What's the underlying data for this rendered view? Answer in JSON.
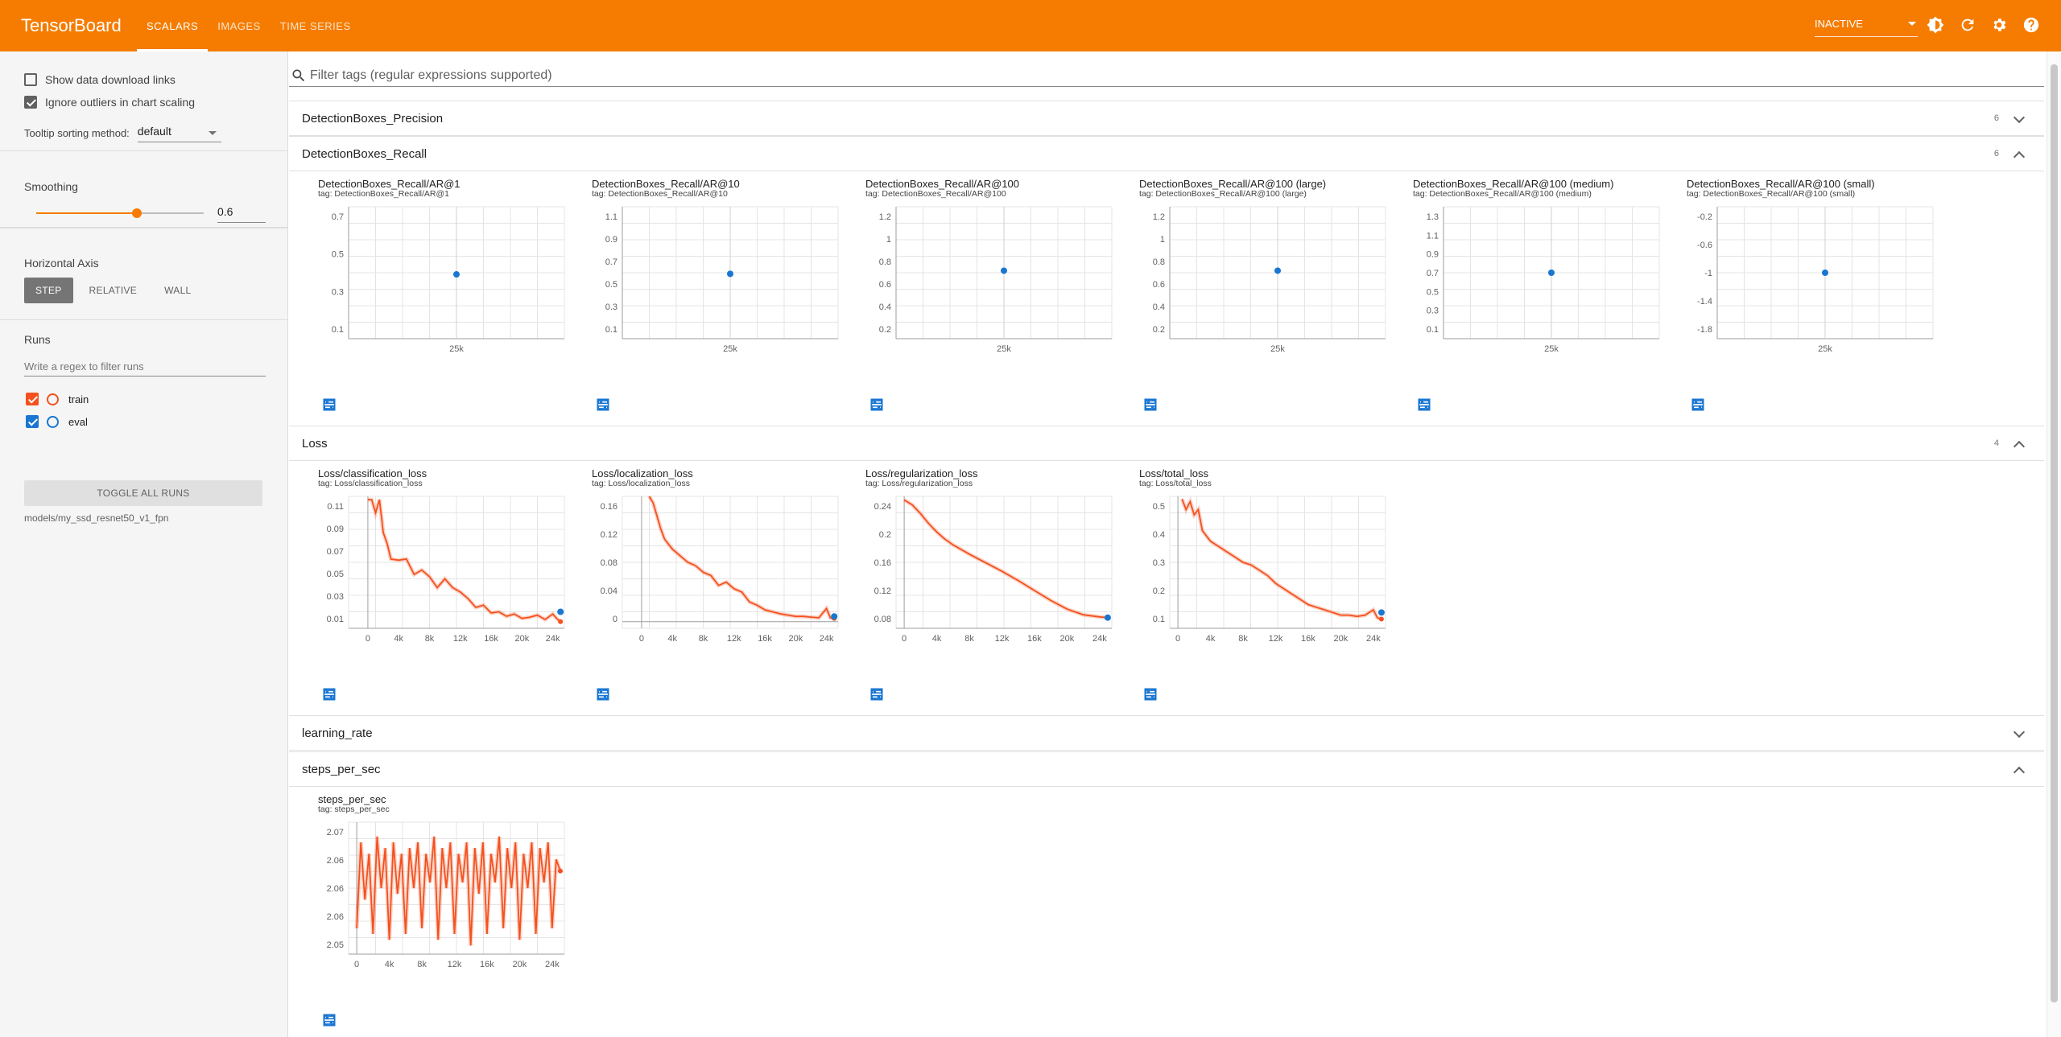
{
  "topbar": {
    "brand": "TensorBoard",
    "tabs": [
      {
        "label": "SCALARS",
        "active": true
      },
      {
        "label": "IMAGES",
        "active": false
      },
      {
        "label": "TIME SERIES",
        "active": false
      }
    ],
    "reload_status": "INACTIVE",
    "colors": {
      "bar": "#f57c00",
      "text": "#ffffff"
    },
    "icons": [
      "brightness-icon",
      "refresh-icon",
      "settings-icon",
      "help-icon"
    ]
  },
  "sidebar": {
    "show_download_links": {
      "label": "Show data download links",
      "checked": false
    },
    "ignore_outliers": {
      "label": "Ignore outliers in chart scaling",
      "checked": true
    },
    "tooltip_sorting": {
      "label": "Tooltip sorting method:",
      "value": "default"
    },
    "smoothing": {
      "label": "Smoothing",
      "value": "0.6",
      "fraction": 0.6
    },
    "horizontal_axis": {
      "label": "Horizontal Axis",
      "options": [
        "STEP",
        "RELATIVE",
        "WALL"
      ],
      "selected": "STEP"
    },
    "runs": {
      "label": "Runs",
      "filter_placeholder": "Write a regex to filter runs",
      "items": [
        {
          "name": "train",
          "color": "#f4511e",
          "checked": true
        },
        {
          "name": "eval",
          "color": "#1976d2",
          "checked": true
        }
      ],
      "toggle_all": "TOGGLE ALL RUNS",
      "logdir": "models/my_ssd_resnet50_v1_fpn"
    }
  },
  "filter": {
    "placeholder": "Filter tags (regular expressions supported)"
  },
  "groups": [
    {
      "name": "DetectionBoxes_Precision",
      "count": "6",
      "expanded": false
    },
    {
      "name": "DetectionBoxes_Recall",
      "count": "6",
      "expanded": true
    },
    {
      "name": "Loss",
      "count": "4",
      "expanded": true
    },
    {
      "name": "learning_rate",
      "count": "",
      "expanded": false
    },
    {
      "name": "steps_per_sec",
      "count": "",
      "expanded": true
    }
  ],
  "chart_data": [
    {
      "type": "scatter",
      "title": "DetectionBoxes_Recall/AR@1",
      "tag": "tag: DetectionBoxes_Recall/AR@1",
      "yticks": [
        "0.7",
        "0.5",
        "0.3",
        "0.1"
      ],
      "xticks": [
        "25k"
      ],
      "ylim": [
        0,
        0.8
      ],
      "xlim": [
        0,
        50000
      ],
      "series": [
        {
          "x": [
            25000
          ],
          "y": [
            0.39
          ],
          "color": "#1976d2"
        }
      ]
    },
    {
      "type": "scatter",
      "title": "DetectionBoxes_Recall/AR@10",
      "tag": "tag: DetectionBoxes_Recall/AR@10",
      "yticks": [
        "1.1",
        "0.9",
        "0.7",
        "0.5",
        "0.3",
        "0.1"
      ],
      "xticks": [
        "25k"
      ],
      "ylim": [
        0,
        1.2
      ],
      "xlim": [
        0,
        50000
      ],
      "series": [
        {
          "x": [
            25000
          ],
          "y": [
            0.59
          ],
          "color": "#1976d2"
        }
      ]
    },
    {
      "type": "scatter",
      "title": "DetectionBoxes_Recall/AR@100",
      "tag": "tag: DetectionBoxes_Recall/AR@100",
      "yticks": [
        "1.2",
        "1",
        "0.8",
        "0.6",
        "0.4",
        "0.2"
      ],
      "xticks": [
        "25k"
      ],
      "ylim": [
        0.05,
        1.35
      ],
      "xlim": [
        0,
        50000
      ],
      "series": [
        {
          "x": [
            25000
          ],
          "y": [
            0.72
          ],
          "color": "#1976d2"
        }
      ]
    },
    {
      "type": "scatter",
      "title": "DetectionBoxes_Recall/AR@100 (large)",
      "tag": "tag: DetectionBoxes_Recall/AR@100 (large)",
      "yticks": [
        "1.2",
        "1",
        "0.8",
        "0.6",
        "0.4",
        "0.2"
      ],
      "xticks": [
        "25k"
      ],
      "ylim": [
        0.05,
        1.35
      ],
      "xlim": [
        0,
        50000
      ],
      "series": [
        {
          "x": [
            25000
          ],
          "y": [
            0.72
          ],
          "color": "#1976d2"
        }
      ]
    },
    {
      "type": "scatter",
      "title": "DetectionBoxes_Recall/AR@100 (medium)",
      "tag": "tag: DetectionBoxes_Recall/AR@100 (medium)",
      "yticks": [
        "1.3",
        "1.1",
        "0.9",
        "0.7",
        "0.5",
        "0.3",
        "0.1"
      ],
      "xticks": [
        "25k"
      ],
      "ylim": [
        0,
        1.4
      ],
      "xlim": [
        0,
        50000
      ],
      "series": [
        {
          "x": [
            25000
          ],
          "y": [
            0.7
          ],
          "color": "#1976d2"
        }
      ]
    },
    {
      "type": "scatter",
      "title": "DetectionBoxes_Recall/AR@100 (small)",
      "tag": "tag: DetectionBoxes_Recall/AR@100 (small)",
      "yticks": [
        "-0.2",
        "-0.6",
        "-1",
        "-1.4",
        "-1.8"
      ],
      "xticks": [
        "25k"
      ],
      "ylim": [
        -2.0,
        0
      ],
      "xlim": [
        0,
        50000
      ],
      "series": [
        {
          "x": [
            25000
          ],
          "y": [
            -1.0
          ],
          "color": "#1976d2"
        }
      ]
    },
    {
      "type": "line",
      "title": "Loss/classification_loss",
      "tag": "tag: Loss/classification_loss",
      "yticks": [
        "0.11",
        "0.09",
        "0.07",
        "0.05",
        "0.03",
        "0.01"
      ],
      "xticks": [
        "0",
        "4k",
        "8k",
        "12k",
        "16k",
        "20k",
        "24k"
      ],
      "ylim": [
        0.003,
        0.123
      ],
      "xlim": [
        -2500,
        25500
      ],
      "series": [
        {
          "color": "#f4511e",
          "x": [
            0,
            500,
            1000,
            1500,
            2000,
            2500,
            3000,
            4000,
            5000,
            6000,
            7000,
            8000,
            9000,
            10000,
            11000,
            12000,
            13000,
            14000,
            15000,
            16000,
            17000,
            18000,
            19000,
            20000,
            21000,
            22000,
            23000,
            24000,
            24500,
            25000
          ],
          "y": [
            0.12,
            0.12,
            0.108,
            0.12,
            0.09,
            0.08,
            0.066,
            0.065,
            0.066,
            0.052,
            0.056,
            0.05,
            0.04,
            0.048,
            0.04,
            0.036,
            0.03,
            0.022,
            0.024,
            0.017,
            0.018,
            0.014,
            0.016,
            0.012,
            0.013,
            0.015,
            0.011,
            0.016,
            0.012,
            0.009
          ]
        },
        {
          "color": "#1976d2",
          "x": [
            25000
          ],
          "y": [
            0.018
          ]
        }
      ]
    },
    {
      "type": "line",
      "title": "Loss/localization_loss",
      "tag": "tag: Loss/localization_loss",
      "yticks": [
        "0.16",
        "0.12",
        "0.08",
        "0.04",
        "0"
      ],
      "xticks": [
        "0",
        "4k",
        "8k",
        "12k",
        "16k",
        "20k",
        "24k"
      ],
      "ylim": [
        -0.01,
        0.19
      ],
      "xlim": [
        -2500,
        25500
      ],
      "series": [
        {
          "color": "#f4511e",
          "x": [
            1000,
            1500,
            2000,
            2500,
            3000,
            4000,
            5000,
            6000,
            7000,
            8000,
            9000,
            10000,
            11000,
            12000,
            13000,
            14000,
            15000,
            16000,
            17000,
            18000,
            19000,
            20000,
            21000,
            22000,
            23000,
            24000,
            24500,
            25000
          ],
          "y": [
            0.19,
            0.18,
            0.16,
            0.14,
            0.125,
            0.11,
            0.1,
            0.09,
            0.085,
            0.075,
            0.07,
            0.055,
            0.06,
            0.05,
            0.045,
            0.03,
            0.025,
            0.018,
            0.015,
            0.012,
            0.01,
            0.008,
            0.008,
            0.007,
            0.006,
            0.02,
            0.006,
            0.005
          ]
        },
        {
          "color": "#1976d2",
          "x": [
            25000
          ],
          "y": [
            0.008
          ]
        }
      ]
    },
    {
      "type": "line",
      "title": "Loss/regularization_loss",
      "tag": "tag: Loss/regularization_loss",
      "yticks": [
        "0.24",
        "0.2",
        "0.16",
        "0.12",
        "0.08"
      ],
      "xticks": [
        "0",
        "4k",
        "8k",
        "12k",
        "16k",
        "20k",
        "24k"
      ],
      "ylim": [
        0.065,
        0.25
      ],
      "xlim": [
        -1000,
        25500
      ],
      "series": [
        {
          "color": "#f4511e",
          "x": [
            0,
            1000,
            2000,
            3000,
            4000,
            5000,
            6000,
            8000,
            10000,
            12000,
            14000,
            16000,
            18000,
            20000,
            22000,
            24000,
            25000
          ],
          "y": [
            0.245,
            0.238,
            0.226,
            0.212,
            0.2,
            0.19,
            0.182,
            0.169,
            0.157,
            0.145,
            0.132,
            0.118,
            0.104,
            0.092,
            0.084,
            0.081,
            0.08
          ]
        },
        {
          "color": "#1976d2",
          "x": [
            25000
          ],
          "y": [
            0.08
          ]
        }
      ]
    },
    {
      "type": "line",
      "title": "Loss/total_loss",
      "tag": "tag: Loss/total_loss",
      "yticks": [
        "0.5",
        "0.4",
        "0.3",
        "0.2",
        "0.1"
      ],
      "xticks": [
        "0",
        "4k",
        "8k",
        "12k",
        "16k",
        "20k",
        "24k"
      ],
      "ylim": [
        0.05,
        0.55
      ],
      "xlim": [
        -1000,
        25500
      ],
      "series": [
        {
          "color": "#f4511e",
          "x": [
            500,
            1000,
            1500,
            2000,
            2500,
            3000,
            4000,
            5000,
            6000,
            7000,
            8000,
            9000,
            10000,
            11000,
            12000,
            13000,
            14000,
            15000,
            16000,
            17000,
            18000,
            19000,
            20000,
            21000,
            22000,
            23000,
            24000,
            24500,
            25000
          ],
          "y": [
            0.54,
            0.5,
            0.53,
            0.48,
            0.5,
            0.42,
            0.38,
            0.36,
            0.34,
            0.32,
            0.3,
            0.29,
            0.27,
            0.25,
            0.22,
            0.2,
            0.18,
            0.16,
            0.14,
            0.13,
            0.12,
            0.11,
            0.1,
            0.1,
            0.095,
            0.1,
            0.12,
            0.09,
            0.085
          ]
        },
        {
          "color": "#1976d2",
          "x": [
            25000
          ],
          "y": [
            0.11
          ]
        }
      ]
    },
    {
      "type": "line",
      "title": "steps_per_sec",
      "tag": "tag: steps_per_sec",
      "yticks": [
        "2.07",
        "2.06",
        "2.06",
        "2.06",
        "2.05"
      ],
      "xticks": [
        "0",
        "4k",
        "8k",
        "12k",
        "16k",
        "20k",
        "24k"
      ],
      "ylim": [
        2.0485,
        2.0715
      ],
      "xlim": [
        -1000,
        25500
      ],
      "series": [
        {
          "color": "#f4511e",
          "x": [
            0,
            500,
            1000,
            1500,
            2000,
            2500,
            3000,
            3500,
            4000,
            4500,
            5000,
            5500,
            6000,
            6500,
            7000,
            7500,
            8000,
            8500,
            9000,
            9500,
            10000,
            10500,
            11000,
            11500,
            12000,
            12500,
            13000,
            13500,
            14000,
            14500,
            15000,
            15500,
            16000,
            16500,
            17000,
            17500,
            18000,
            18500,
            19000,
            19500,
            20000,
            20500,
            21000,
            21500,
            22000,
            22500,
            23000,
            23500,
            24000,
            24500,
            25000
          ],
          "y": [
            2.053,
            2.068,
            2.058,
            2.066,
            2.052,
            2.069,
            2.06,
            2.067,
            2.051,
            2.068,
            2.059,
            2.066,
            2.052,
            2.067,
            2.06,
            2.068,
            2.053,
            2.066,
            2.061,
            2.069,
            2.051,
            2.067,
            2.06,
            2.068,
            2.052,
            2.066,
            2.061,
            2.068,
            2.05,
            2.067,
            2.059,
            2.068,
            2.052,
            2.066,
            2.061,
            2.069,
            2.053,
            2.067,
            2.06,
            2.068,
            2.051,
            2.066,
            2.06,
            2.068,
            2.052,
            2.067,
            2.061,
            2.068,
            2.053,
            2.065,
            2.063
          ]
        }
      ]
    }
  ]
}
